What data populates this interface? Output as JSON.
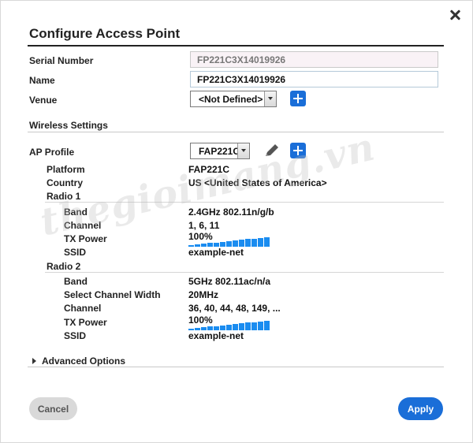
{
  "dialog": {
    "title": "Configure Access Point",
    "close_icon": "close-icon"
  },
  "form": {
    "serial_number": {
      "label": "Serial Number",
      "value": "FP221C3X14019926"
    },
    "name": {
      "label": "Name",
      "value": "FP221C3X14019926"
    },
    "venue": {
      "label": "Venue",
      "selected": "<Not Defined>"
    }
  },
  "wireless": {
    "section_title": "Wireless Settings",
    "ap_profile": {
      "label": "AP Profile",
      "selected": "FAP221C"
    },
    "platform": {
      "label": "Platform",
      "value": "FAP221C"
    },
    "country": {
      "label": "Country",
      "value": "US <United States of America>"
    },
    "radio1": {
      "title": "Radio 1",
      "band": {
        "label": "Band",
        "value": "2.4GHz 802.11n/g/b"
      },
      "channel": {
        "label": "Channel",
        "value": "1, 6, 11"
      },
      "tx_power": {
        "label": "TX Power",
        "value": "100%",
        "level_percent": 100
      },
      "ssid": {
        "label": "SSID",
        "value": "example-net"
      }
    },
    "radio2": {
      "title": "Radio 2",
      "band": {
        "label": "Band",
        "value": "5GHz 802.11ac/n/a"
      },
      "channel_width": {
        "label": "Select Channel Width",
        "value": "20MHz"
      },
      "channel": {
        "label": "Channel",
        "value": "36, 40, 44, 48, 149, ..."
      },
      "tx_power": {
        "label": "TX Power",
        "value": "100%",
        "level_percent": 100
      },
      "ssid": {
        "label": "SSID",
        "value": "example-net"
      }
    }
  },
  "advanced": {
    "label": "Advanced Options"
  },
  "buttons": {
    "cancel": "Cancel",
    "apply": "Apply"
  },
  "watermark": "thegioimang.vn",
  "colors": {
    "accent": "#1a6ed8",
    "power_bar": "#1a8cf0"
  }
}
